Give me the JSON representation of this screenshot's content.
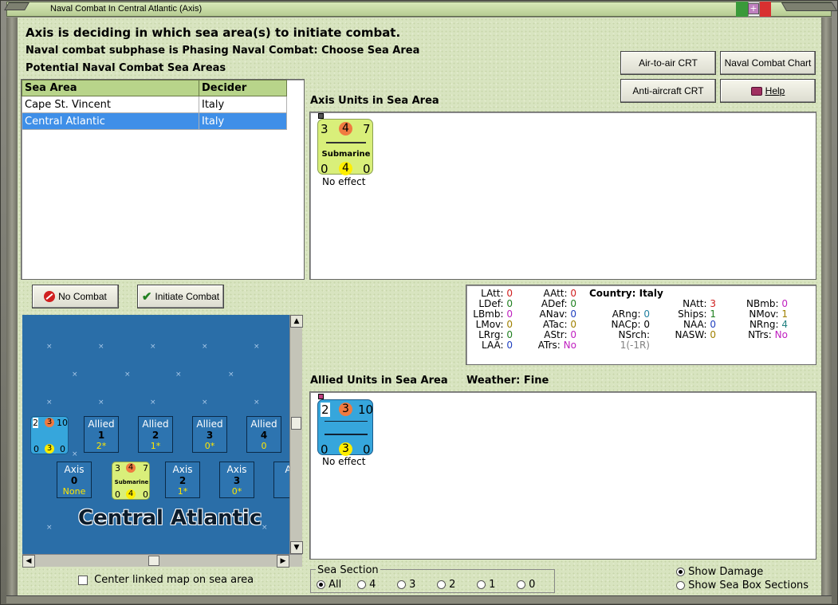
{
  "window": {
    "title": "Naval Combat In Central Atlantic (Axis)"
  },
  "header": {
    "line1": "Axis is deciding in which sea area(s) to initiate combat.",
    "line2": "Naval combat subphase is Phasing Naval Combat: Choose Sea Area",
    "line3": "Potential Naval Combat Sea Areas"
  },
  "buttons": {
    "air_to_air": "Air-to-air CRT",
    "naval_chart": "Naval Combat Chart",
    "anti_aircraft": "Anti-aircraft CRT",
    "help": "Help",
    "no_combat": "No Combat",
    "initiate": "Initiate Combat"
  },
  "sea_table": {
    "headers": [
      "Sea Area",
      "Decider"
    ],
    "rows": [
      {
        "area": "Cape St. Vincent",
        "decider": "Italy"
      },
      {
        "area": "Central Atlantic",
        "decider": "Italy"
      }
    ]
  },
  "axis_units": {
    "label": "Axis Units in Sea Area",
    "counter": {
      "top": [
        "3",
        "4",
        "7"
      ],
      "name": "Submarine",
      "bottom": [
        "0",
        "4",
        "0"
      ]
    },
    "status": "No effect"
  },
  "allied_units": {
    "label": "Allied Units in Sea Area",
    "weather_label": "Weather:",
    "weather_value": "Fine",
    "counter": {
      "top": [
        "2",
        "3",
        "10"
      ],
      "bottom": [
        "0",
        "3",
        "0"
      ]
    },
    "status": "No effect"
  },
  "stats": {
    "country_label": "Country:",
    "country": "Italy",
    "col1": [
      {
        "k": "LAtt:",
        "v": "0",
        "c": "#d02020"
      },
      {
        "k": "LDef:",
        "v": "0",
        "c": "#208020"
      },
      {
        "k": "LBmb:",
        "v": "0",
        "c": "#c020c0"
      },
      {
        "k": "LMov:",
        "v": "0",
        "c": "#a08000"
      },
      {
        "k": "LRrg:",
        "v": "0",
        "c": "#208020"
      },
      {
        "k": "LAA:",
        "v": "0",
        "c": "#2040c0"
      }
    ],
    "col2": [
      {
        "k": "AAtt:",
        "v": "0",
        "c": "#d02020"
      },
      {
        "k": "ADef:",
        "v": "0",
        "c": "#208020"
      },
      {
        "k": "ANav:",
        "v": "0",
        "c": "#2040c0"
      },
      {
        "k": "ATac:",
        "v": "0",
        "c": "#a08000"
      },
      {
        "k": "AStr:",
        "v": "0",
        "c": "#c020c0"
      },
      {
        "k": "ATrs:",
        "v": "No",
        "c": "#c020c0"
      }
    ],
    "col3": [
      {
        "k": "ARng:",
        "v": "0",
        "c": "#2080a0"
      },
      {
        "k": "NACp:",
        "v": "0",
        "c": "#000000"
      },
      {
        "k": "NSrch:",
        "v": "1(-1R)",
        "c": "#808080"
      }
    ],
    "col4": [
      {
        "k": "NAtt:",
        "v": "3",
        "c": "#d02020"
      },
      {
        "k": "Ships:",
        "v": "1",
        "c": "#208020"
      },
      {
        "k": "NAA:",
        "v": "0",
        "c": "#2040c0"
      },
      {
        "k": "NASW:",
        "v": "0",
        "c": "#a08000"
      }
    ],
    "col5": [
      {
        "k": "NBmb:",
        "v": "0",
        "c": "#c020c0"
      },
      {
        "k": "NMov:",
        "v": "1",
        "c": "#a08000"
      },
      {
        "k": "NRng:",
        "v": "4",
        "c": "#208080"
      },
      {
        "k": "NTrs:",
        "v": "No",
        "c": "#c020c0"
      }
    ]
  },
  "map": {
    "title": "Central Atlantic",
    "allied_boxes": [
      {
        "label": "Allied",
        "num": "1",
        "val": "2*"
      },
      {
        "label": "Allied",
        "num": "2",
        "val": "1*"
      },
      {
        "label": "Allied",
        "num": "3",
        "val": "0*"
      },
      {
        "label": "Allied",
        "num": "4",
        "val": "0"
      }
    ],
    "axis_boxes": [
      {
        "label": "Axis",
        "num": "0",
        "val": "None"
      },
      {
        "label": "Axis",
        "num": "2",
        "val": "1*"
      },
      {
        "label": "Axis",
        "num": "3",
        "val": "0*"
      },
      {
        "label": "Ax",
        "num": "",
        "val": ""
      }
    ],
    "map_sub": {
      "top": [
        "3",
        "4",
        "7"
      ],
      "name": "Submarine",
      "bottom": [
        "0",
        "4",
        "0"
      ]
    },
    "map_allied": {
      "top": [
        "2",
        "3",
        "10"
      ],
      "bottom": [
        "0",
        "3",
        "0"
      ]
    }
  },
  "center_linked": "Center linked map on sea area",
  "sea_section": {
    "title": "Sea Section",
    "options": [
      "All",
      "4",
      "3",
      "2",
      "1",
      "0"
    ]
  },
  "show_damage": "Show Damage",
  "show_sections": "Show Sea Box Sections"
}
